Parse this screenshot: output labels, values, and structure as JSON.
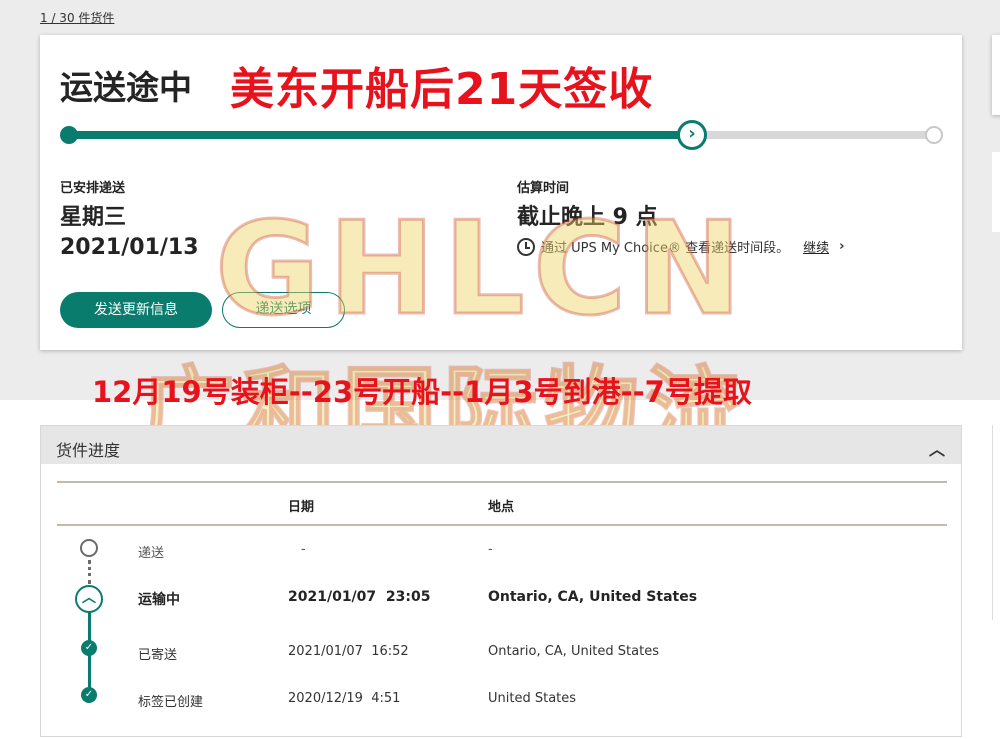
{
  "pager": {
    "text": "1 / 30 件货件"
  },
  "status": {
    "title": "运送途中",
    "overlay_headline": "美东开船后21天签收"
  },
  "progress": {
    "completed_fraction": 0.72
  },
  "scheduled": {
    "label": "已安排递送",
    "day": "星期三",
    "date": "2021/01/13"
  },
  "estimate": {
    "label": "估算时间",
    "value": "截止晚上 9 点",
    "ups_text": "通过 UPS My Choice® 查看递送时间段。",
    "continue_link": "继续"
  },
  "buttons": {
    "send_updates": "发送更新信息",
    "delivery_options": "递送选项"
  },
  "overlay_timeline": "12月19号装柜--23号开船--1月3号到港--7号提取",
  "watermark": {
    "line1": "GHLCN",
    "line2": "广和国际物流"
  },
  "shipment_progress": {
    "title": "货件进度",
    "columns": {
      "date": "日期",
      "location": "地点"
    },
    "rows": [
      {
        "status": "递送",
        "date": "-",
        "location": "-"
      },
      {
        "status": "运输中",
        "date": "2021/01/07  23:05",
        "location": "Ontario, CA, United States"
      },
      {
        "status": "已寄送",
        "date": "2021/01/07  16:52",
        "location": "Ontario, CA, United States"
      },
      {
        "status": "标签已创建",
        "date": "2020/12/19  4:51",
        "location": "United States"
      }
    ]
  },
  "colors": {
    "brand": "#0a7c6e",
    "overlay_red": "#e8121c"
  }
}
